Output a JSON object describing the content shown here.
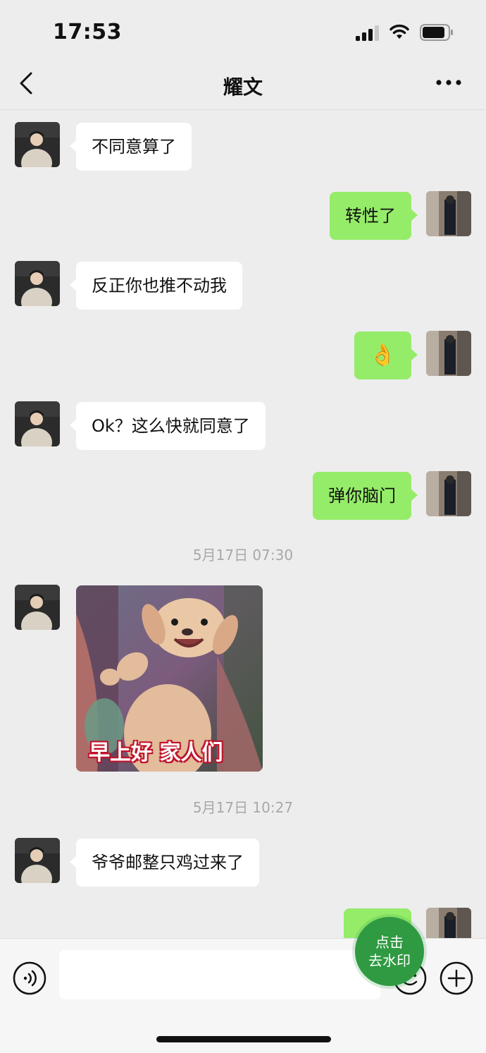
{
  "status_bar": {
    "time": "17:53",
    "signal_icon": "cellular-signal-icon",
    "wifi_icon": "wifi-icon",
    "battery_icon": "battery-icon"
  },
  "nav": {
    "title": "耀文",
    "back_icon": "chevron-left-icon",
    "more_icon": "more-dots-icon"
  },
  "messages": [
    {
      "side": "in",
      "text": "不同意算了"
    },
    {
      "side": "out",
      "text": "转性了"
    },
    {
      "side": "in",
      "text": "反正你也推不动我"
    },
    {
      "side": "out",
      "emoji": "👌"
    },
    {
      "side": "in",
      "text": "Ok？这么快就同意了"
    },
    {
      "side": "out",
      "text": "弹你脑门"
    },
    {
      "type": "timestamp",
      "text": "5月17日 07:30"
    },
    {
      "side": "in",
      "type": "sticker",
      "caption": "早上好 家人们"
    },
    {
      "type": "timestamp",
      "text": "5月17日 10:27"
    },
    {
      "side": "in",
      "text": "爷爷邮整只鸡过来了"
    },
    {
      "side": "out",
      "text": ""
    }
  ],
  "input_bar": {
    "voice_icon": "voice-icon",
    "emoji_icon": "emoji-icon",
    "plus_icon": "plus-circle-icon"
  },
  "watermark_button": {
    "line1": "点击",
    "line2": "去水印"
  },
  "colors": {
    "background": "#ededed",
    "incoming_bubble": "#ffffff",
    "outgoing_bubble": "#95ec69",
    "accent": "#2f9a42"
  }
}
